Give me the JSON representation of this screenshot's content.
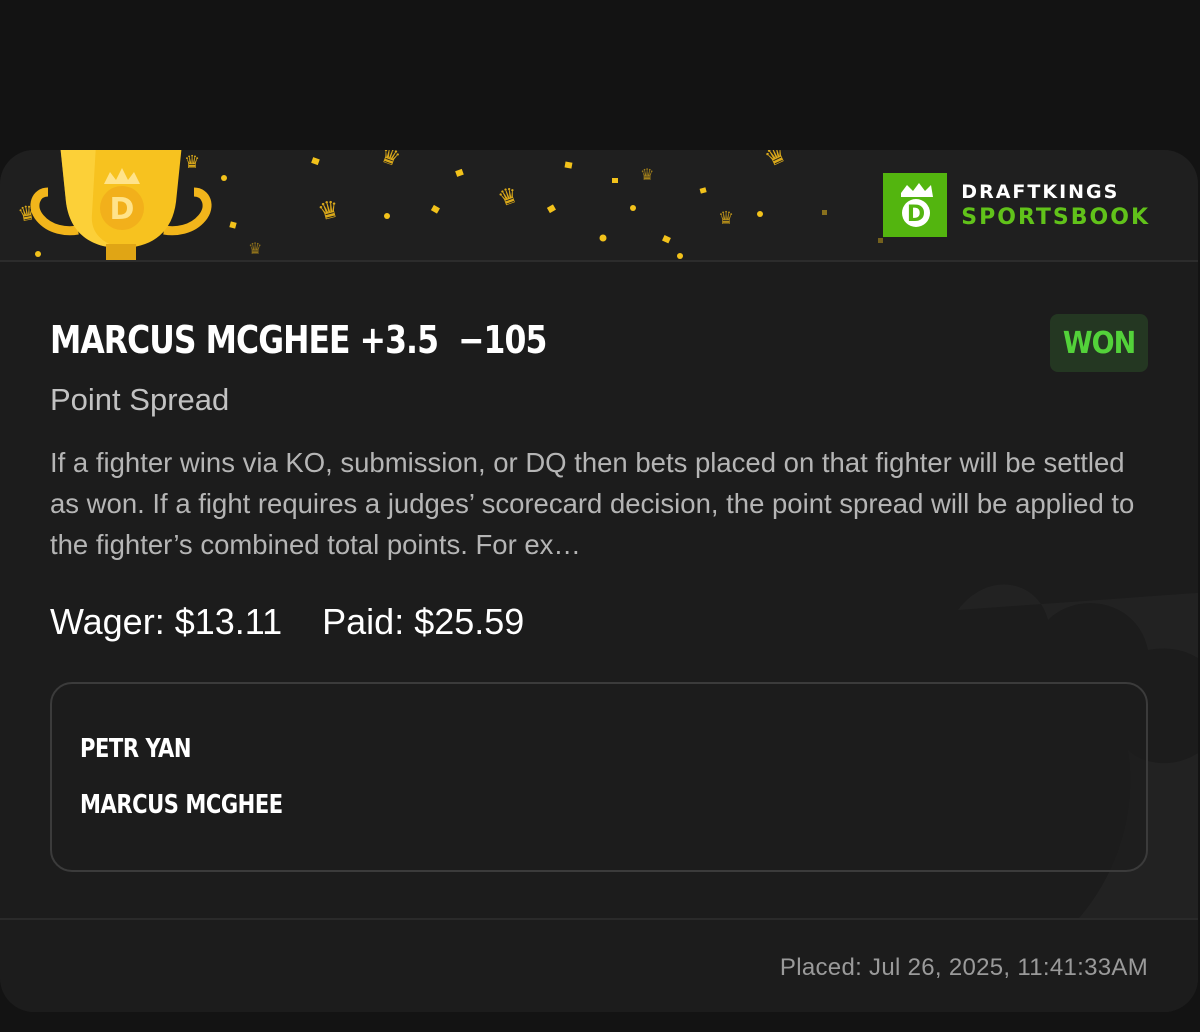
{
  "brand": {
    "line1": "DRAFTKINGS",
    "line2": "SPORTSBOOK",
    "accent_color": "#53b50f",
    "icon": "draftkings-crown-d-logo"
  },
  "bet": {
    "title": "MARCUS MCGHEE +3.5  −105",
    "status": "WON",
    "status_color": "#53d23a",
    "market": "Point Spread",
    "description": "If a fighter wins via KO, submission, or DQ then bets placed on that fighter will be settled as won. If a fight requires a judges’ scorecard decision, the point spread will be applied to the fighter’s combined total points. For ex…",
    "wager_label": "Wager: $13.11",
    "paid_label": "Paid: $25.59"
  },
  "matchup": {
    "fighters": [
      "PETR YAN",
      "MARCUS MCGHEE"
    ]
  },
  "footer": {
    "placed": "Placed: Jul 26, 2025, 11:41:33AM"
  },
  "decor": {
    "banner_icon": "trophy-icon",
    "confetti_color": "#f2c21b"
  }
}
